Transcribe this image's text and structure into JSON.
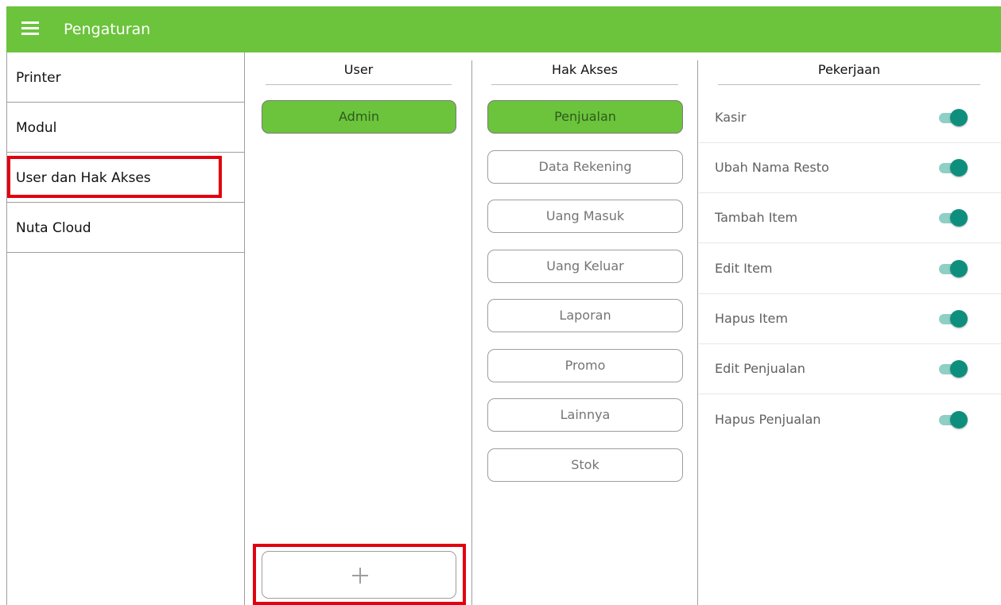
{
  "app": {
    "title": "Pengaturan",
    "accent": "#6bc43c",
    "toggle_color": "#0e8f7e",
    "highlight": "#e3000f"
  },
  "sidebar": {
    "items": [
      {
        "label": "Printer"
      },
      {
        "label": "Modul"
      },
      {
        "label": "User dan Hak Akses",
        "highlighted": true
      },
      {
        "label": "Nuta Cloud"
      }
    ]
  },
  "user_column": {
    "header": "User",
    "users": [
      {
        "label": "Admin",
        "selected": true
      }
    ],
    "add_button_icon": "plus-icon"
  },
  "access_column": {
    "header": "Hak Akses",
    "items": [
      {
        "label": "Penjualan",
        "selected": true
      },
      {
        "label": "Data Rekening"
      },
      {
        "label": "Uang Masuk"
      },
      {
        "label": "Uang Keluar"
      },
      {
        "label": "Laporan"
      },
      {
        "label": "Promo"
      },
      {
        "label": "Lainnya"
      },
      {
        "label": "Stok"
      }
    ]
  },
  "jobs_column": {
    "header": "Pekerjaan",
    "items": [
      {
        "label": "Kasir",
        "enabled": true
      },
      {
        "label": "Ubah Nama Resto",
        "enabled": true
      },
      {
        "label": "Tambah Item",
        "enabled": true
      },
      {
        "label": "Edit Item",
        "enabled": true
      },
      {
        "label": "Hapus Item",
        "enabled": true
      },
      {
        "label": "Edit Penjualan",
        "enabled": true
      },
      {
        "label": "Hapus Penjualan",
        "enabled": true
      }
    ]
  }
}
